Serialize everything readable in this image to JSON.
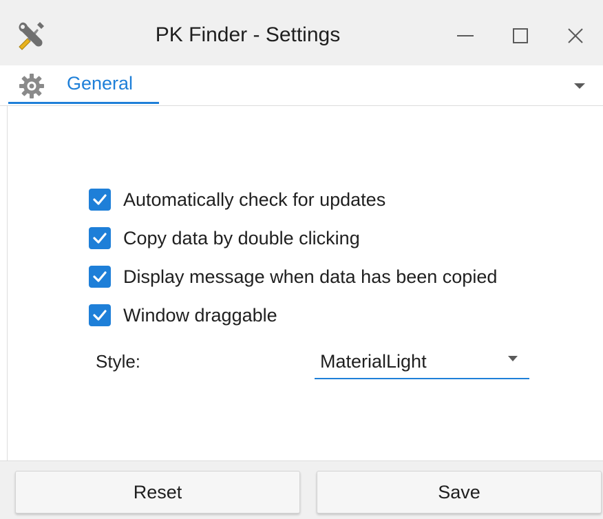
{
  "window": {
    "title": "PK Finder - Settings"
  },
  "icons": {
    "app": "tools-icon",
    "tab": "gear-icon",
    "minimize": "minimize-icon",
    "maximize": "maximize-icon",
    "close": "close-icon",
    "tab_menu": "chevron-down-icon",
    "checkbox": "checkmark-icon",
    "select_arrow": "chevron-down-icon"
  },
  "tabs": [
    {
      "label": "General",
      "active": true
    }
  ],
  "settings": {
    "options": [
      {
        "label": "Automatically check for updates",
        "checked": true
      },
      {
        "label": "Copy data by double clicking",
        "checked": true
      },
      {
        "label": "Display message when data has been copied",
        "checked": true
      },
      {
        "label": "Window draggable",
        "checked": true
      }
    ],
    "style_label": "Style:",
    "style_value": "MaterialLight"
  },
  "footer": {
    "reset_label": "Reset",
    "save_label": "Save"
  },
  "colors": {
    "accent": "#1e7fd8",
    "titlebar_bg": "#f0f0f0",
    "text": "#1f1f1f"
  }
}
